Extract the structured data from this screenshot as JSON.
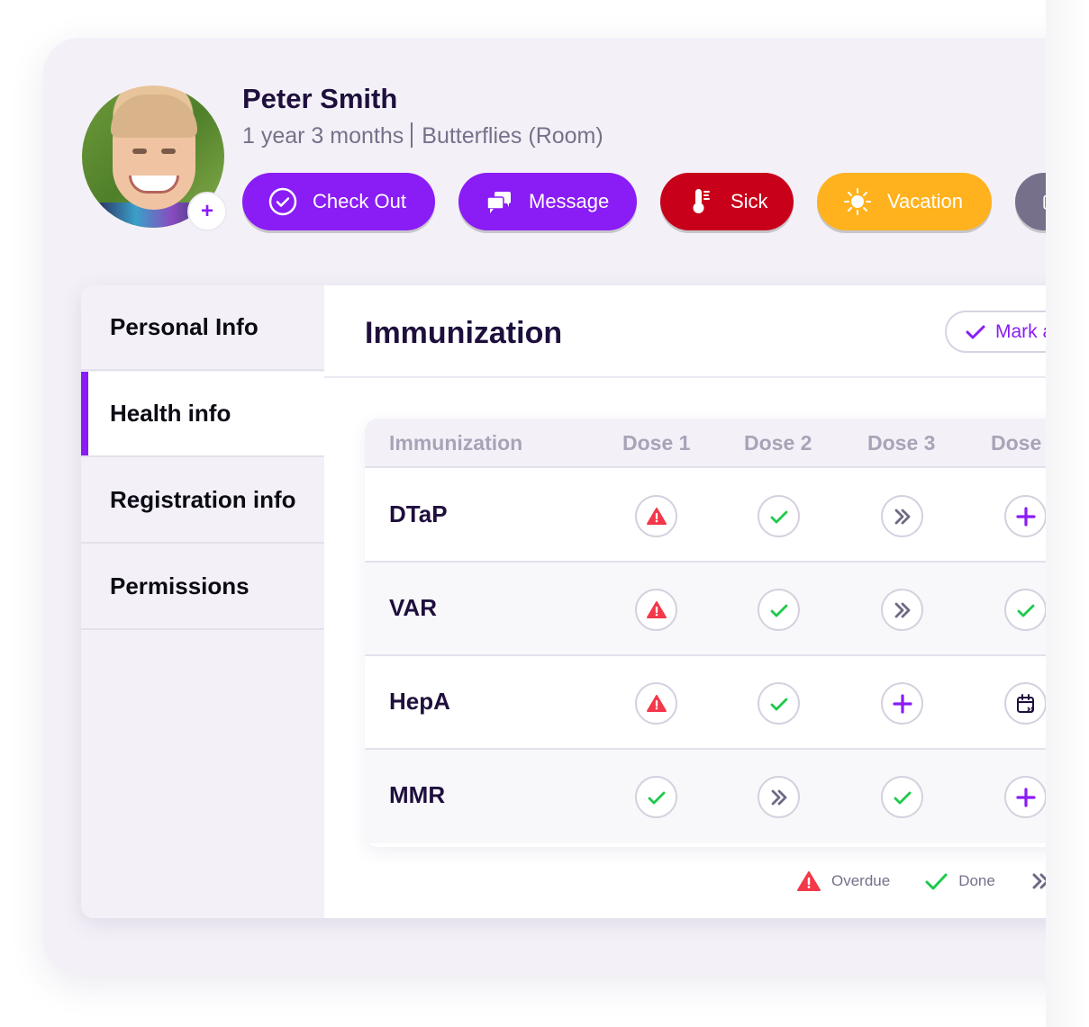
{
  "profile": {
    "name": "Peter Smith",
    "age": "1 year 3 months",
    "room": "Butterflies (Room)",
    "avatar_add_label": "+"
  },
  "actions": [
    {
      "label": "Check Out",
      "icon": "check-circle-icon",
      "color": "#8a1cf5"
    },
    {
      "label": "Message",
      "icon": "chat-bubbles-icon",
      "color": "#8a1cf5"
    },
    {
      "label": "Sick",
      "icon": "thermometer-icon",
      "color": "#c8001a"
    },
    {
      "label": "Vacation",
      "icon": "sun-icon",
      "color": "#ffb21e"
    },
    {
      "label": "",
      "icon": "calendar-icon",
      "color": "#77708a"
    }
  ],
  "sidebar": {
    "items": [
      {
        "label": "Personal Info",
        "active": false
      },
      {
        "label": "Health info",
        "active": true
      },
      {
        "label": "Registration info",
        "active": false
      },
      {
        "label": "Permissions",
        "active": false
      }
    ]
  },
  "content": {
    "title": "Immunization",
    "mark_button_label": "Mark a"
  },
  "table": {
    "headers": [
      "Immunization",
      "Dose 1",
      "Dose 2",
      "Dose 3",
      "Dose"
    ],
    "rows": [
      {
        "name": "DTaP",
        "doses": [
          "overdue",
          "done",
          "skipped",
          "add"
        ]
      },
      {
        "name": "VAR",
        "doses": [
          "overdue",
          "done",
          "skipped",
          "done"
        ]
      },
      {
        "name": "HepA",
        "doses": [
          "overdue",
          "done",
          "add",
          "scheduled"
        ]
      },
      {
        "name": "MMR",
        "doses": [
          "done",
          "skipped",
          "done",
          "add"
        ]
      }
    ]
  },
  "legend": [
    {
      "status": "overdue",
      "label": "Overdue"
    },
    {
      "status": "done",
      "label": "Done"
    },
    {
      "status": "skipped",
      "label": ""
    }
  ],
  "colors": {
    "accent": "#8a1cf5",
    "overdue": "#f2384a",
    "done": "#1ec94c",
    "skipped": "#6f6884",
    "title": "#1f0f3d"
  }
}
